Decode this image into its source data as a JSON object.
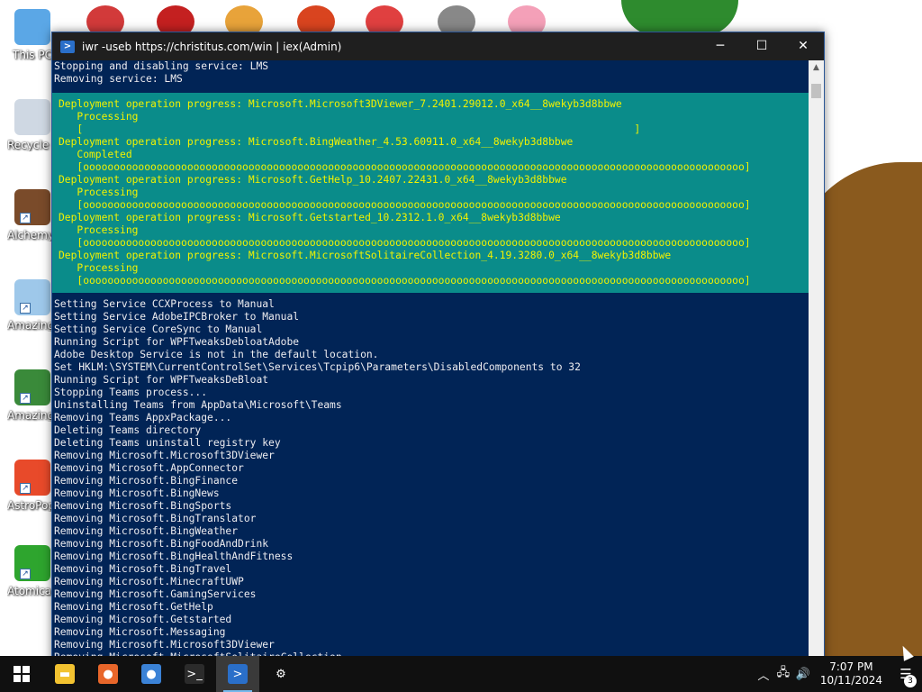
{
  "desktop": {
    "icons": [
      {
        "label": "This PC",
        "icon": "computer-icon",
        "color": "#5ba7e6"
      },
      {
        "label": "Recycle Bin",
        "icon": "recycle-bin-icon",
        "color": "#cfd8e3"
      },
      {
        "label": "Alchemy Deluxe",
        "icon": "wizard-icon",
        "color": "#7a4b2a"
      },
      {
        "label": "Amazing Adventures",
        "icon": "diamond-icon",
        "color": "#9ec8ea"
      },
      {
        "label": "Amazing Adventures",
        "icon": "globe-icon",
        "color": "#3a8a3a"
      },
      {
        "label": "AstroPop Deluxe",
        "icon": "astropop-icon",
        "color": "#e84a2a"
      },
      {
        "label": "Atomica Deluxe",
        "icon": "radiation-icon",
        "color": "#2ea52e"
      }
    ],
    "top_icons": [
      {
        "icon": "game-icon",
        "color": "#d23a3a"
      },
      {
        "icon": "game-red-icon",
        "color": "#c42020"
      },
      {
        "icon": "chrome-icon",
        "color": "#e8a33a"
      },
      {
        "icon": "shrine-icon",
        "color": "#d9441f"
      },
      {
        "icon": "game-p-icon",
        "color": "#e04040"
      },
      {
        "icon": "skull-icon",
        "color": "#888888"
      },
      {
        "icon": "flower-icon",
        "color": "#f4a0b8"
      }
    ]
  },
  "window": {
    "title": "iwr -useb https://christitus.com/win | iex(Admin)",
    "min_label": "─",
    "max_label": "☐",
    "close_label": "✕",
    "lines_before": [
      "Stopping and disabling service: LMS",
      "Removing service: LMS"
    ],
    "progress_lines": [
      "Deployment operation progress: Microsoft.Microsoft3DViewer_7.2401.29012.0_x64__8wekyb3d8bbwe",
      "   Processing",
      "   [                                                                                          ]",
      "Deployment operation progress: Microsoft.BingWeather_4.53.60911.0_x64__8wekyb3d8bbwe",
      "   Completed",
      "   [oooooooooooooooooooooooooooooooooooooooooooooooooooooooooooooooooooooooooooooooooooooooooooooooooooooooooooo]",
      "Deployment operation progress: Microsoft.GetHelp_10.2407.22431.0_x64__8wekyb3d8bbwe",
      "   Processing",
      "   [oooooooooooooooooooooooooooooooooooooooooooooooooooooooooooooooooooooooooooooooooooooooooooooooooooooooooooo]",
      "Deployment operation progress: Microsoft.Getstarted_10.2312.1.0_x64__8wekyb3d8bbwe",
      "   Processing",
      "   [oooooooooooooooooooooooooooooooooooooooooooooooooooooooooooooooooooooooooooooooooooooooooooooooooooooooooooo]",
      "Deployment operation progress: Microsoft.MicrosoftSolitaireCollection_4.19.3280.0_x64__8wekyb3d8bbwe",
      "   Processing",
      "   [oooooooooooooooooooooooooooooooooooooooooooooooooooooooooooooooooooooooooooooooooooooooooooooooooooooooooooo]"
    ],
    "lines_after": [
      "Setting Service CCXProcess to Manual",
      "Setting Service AdobeIPCBroker to Manual",
      "Setting Service CoreSync to Manual",
      "Running Script for WPFTweaksDebloatAdobe",
      "Adobe Desktop Service is not in the default location.",
      "Set HKLM:\\SYSTEM\\CurrentControlSet\\Services\\Tcpip6\\Parameters\\DisabledComponents to 32",
      "Running Script for WPFTweaksDeBloat",
      "Stopping Teams process...",
      "Uninstalling Teams from AppData\\Microsoft\\Teams",
      "Removing Teams AppxPackage...",
      "Deleting Teams directory",
      "Deleting Teams uninstall registry key",
      "Removing Microsoft.Microsoft3DViewer",
      "Removing Microsoft.AppConnector",
      "Removing Microsoft.BingFinance",
      "Removing Microsoft.BingNews",
      "Removing Microsoft.BingSports",
      "Removing Microsoft.BingTranslator",
      "Removing Microsoft.BingWeather",
      "Removing Microsoft.BingFoodAndDrink",
      "Removing Microsoft.BingHealthAndFitness",
      "Removing Microsoft.BingTravel",
      "Removing Microsoft.MinecraftUWP",
      "Removing Microsoft.GamingServices",
      "Removing Microsoft.GetHelp",
      "Removing Microsoft.Getstarted",
      "Removing Microsoft.Messaging",
      "Removing Microsoft.Microsoft3DViewer",
      "Removing Microsoft.MicrosoftSolitaireCollection"
    ]
  },
  "taskbar": {
    "apps": [
      {
        "name": "file-explorer-icon",
        "glyph": "▬",
        "color": "#f2c230",
        "running": false,
        "active": false
      },
      {
        "name": "firefox-icon",
        "glyph": "●",
        "color": "#e8662a",
        "running": false,
        "active": false
      },
      {
        "name": "chrome-taskbar-icon",
        "glyph": "●",
        "color": "#3b82d6",
        "running": false,
        "active": false
      },
      {
        "name": "terminal-icon",
        "glyph": ">_",
        "color": "#2b2b2b",
        "running": false,
        "active": false
      },
      {
        "name": "powershell-icon",
        "glyph": ">",
        "color": "#2a6fc9",
        "running": true,
        "active": true
      },
      {
        "name": "settings-icon",
        "glyph": "⚙",
        "color": "transparent",
        "running": false,
        "active": false
      }
    ],
    "tray": {
      "chevron": "︿",
      "network": "🖧",
      "volume": "🔊",
      "time": "7:07 PM",
      "date": "10/11/2024",
      "notif_glyph": "☰",
      "notif_count": "3"
    }
  }
}
